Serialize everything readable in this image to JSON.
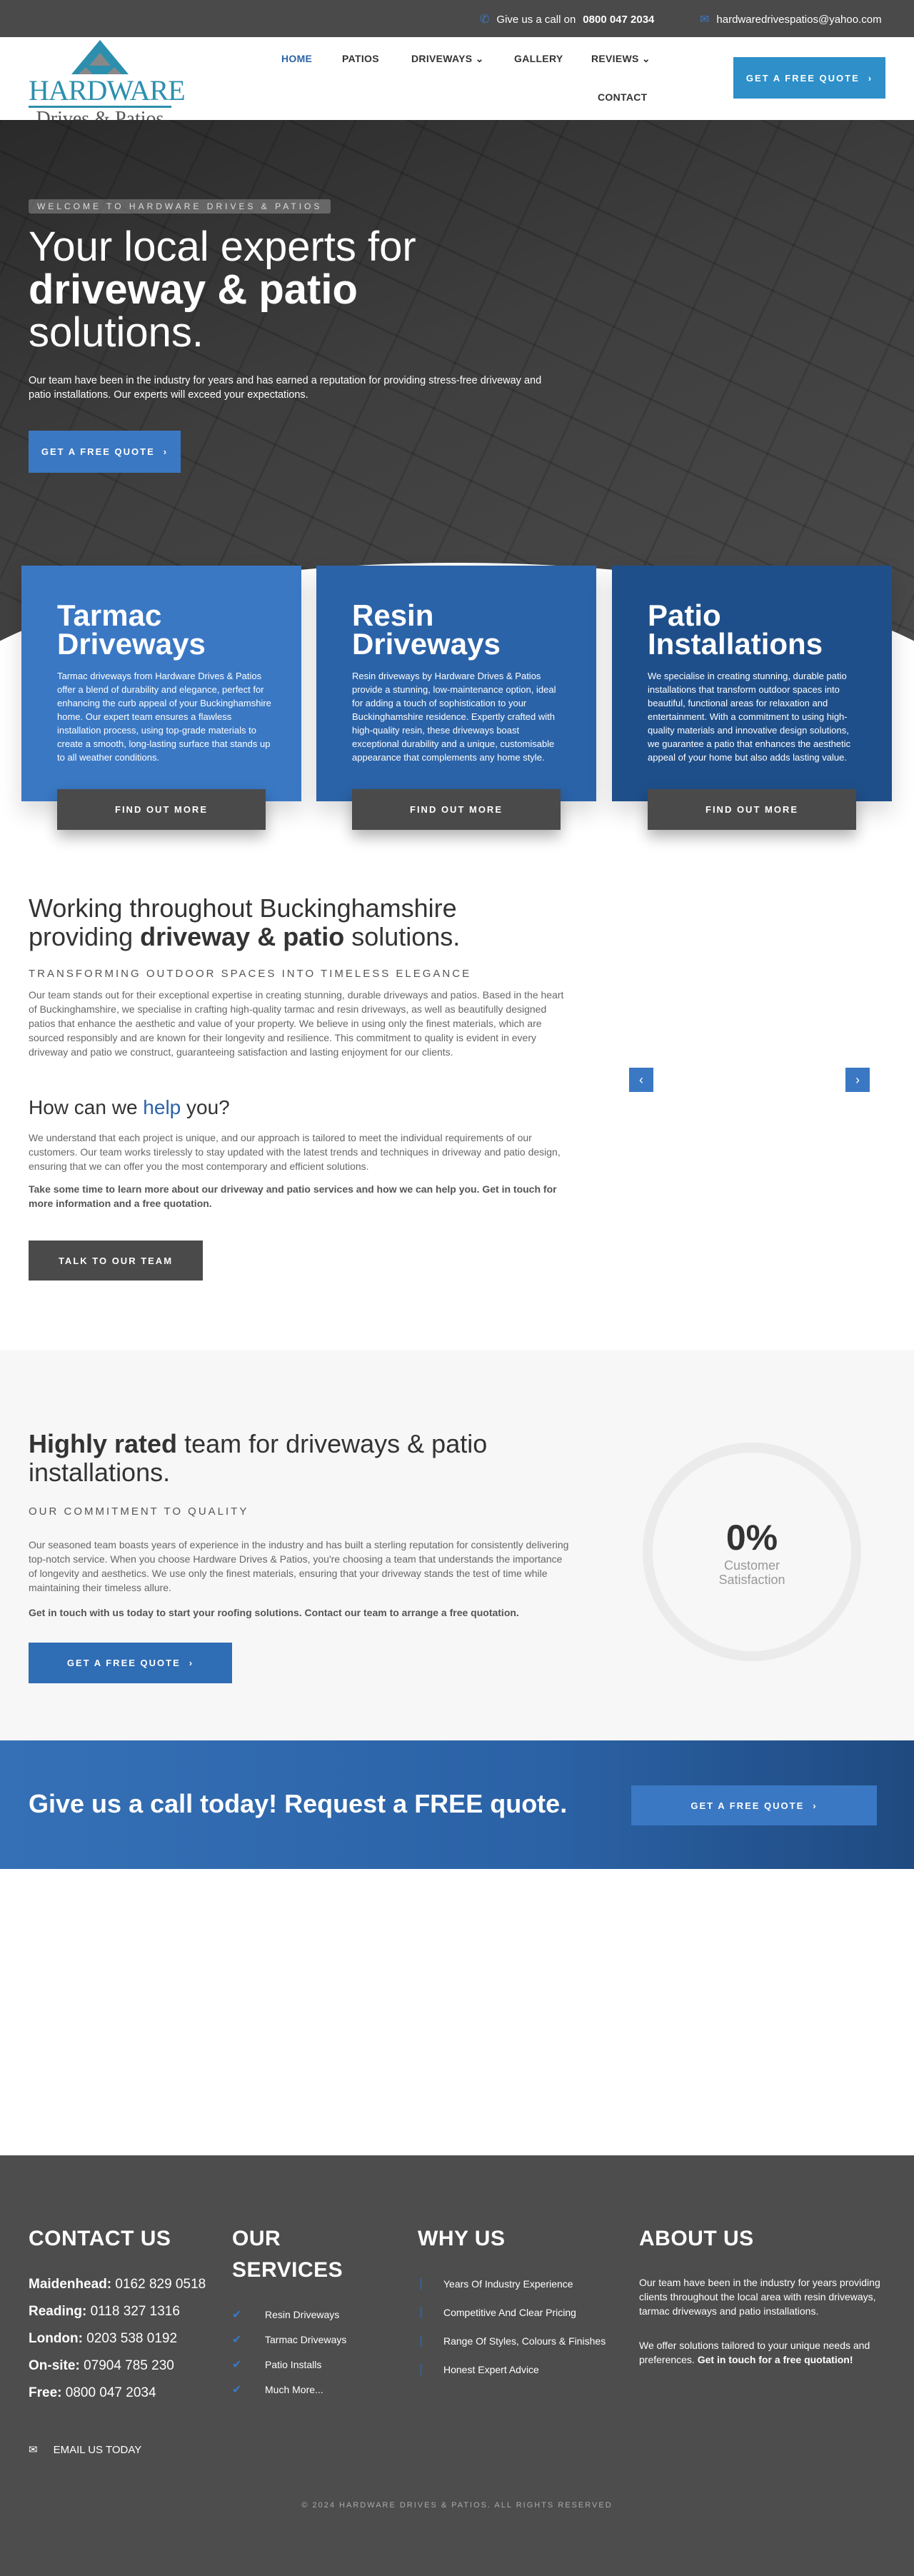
{
  "topbar": {
    "call_prefix": "Give us a call on",
    "phone": "0800 047 2034",
    "email": "hardwaredrivespatios@yahoo.com",
    "phone_icon": "phone-icon",
    "email_icon": "envelope-icon"
  },
  "header": {
    "logo_line1": "HARDWARE",
    "logo_line2": "Drives & Patios",
    "nav": [
      {
        "label": "HOME",
        "active": true
      },
      {
        "label": "PATIOS"
      },
      {
        "label": "DRIVEWAYS",
        "dropdown": true
      },
      {
        "label": "GALLERY"
      },
      {
        "label": "REVIEWS",
        "dropdown": true
      },
      {
        "label": "CONTACT"
      }
    ],
    "cta": "GET A FREE QUOTE"
  },
  "hero": {
    "badge": "WELCOME TO HARDWARE DRIVES & PATIOS",
    "title_line1": "Your local experts for",
    "title_bold": "driveway & patio",
    "title_line3": "solutions.",
    "text": "Our team have been in the industry for years and has earned a reputation for providing stress-free driveway and patio installations. Our experts will exceed your expectations.",
    "cta": "GET A FREE QUOTE"
  },
  "services": [
    {
      "title1": "Tarmac",
      "title2": "Driveways",
      "text": "Tarmac driveways from Hardware Drives & Patios offer a blend of durability and elegance, perfect for enhancing the curb appeal of your Buckinghamshire home. Our expert team ensures a flawless installation process, using top-grade materials to create a smooth, long-lasting surface that stands up to all weather conditions.",
      "button": "FIND OUT MORE",
      "color": "#3a78c4"
    },
    {
      "title1": "Resin",
      "title2": "Driveways",
      "text": "Resin driveways by Hardware Drives & Patios provide a stunning, low-maintenance option, ideal for adding a touch of sophistication to your Buckinghamshire residence. Expertly crafted with high-quality resin, these driveways boast exceptional durability and a unique, customisable appearance that complements any home style.",
      "button": "FIND OUT MORE",
      "color": "#2b63a8"
    },
    {
      "title1": "Patio",
      "title2": "Installations",
      "text": "We specialise in creating stunning, durable patio installations that transform outdoor spaces into beautiful, functional areas for relaxation and entertainment. With a commitment to using high-quality materials and innovative design solutions, we guarantee a patio that enhances the aesthetic appeal of your home but also adds lasting value.",
      "button": "FIND OUT MORE",
      "color": "#1f4f8a"
    }
  ],
  "about": {
    "title_line1": "Working throughout Buckinghamshire",
    "title_pre": "providing",
    "title_bold": "driveway & patio",
    "title_post": "solutions.",
    "subtitle": "TRANSFORMING OUTDOOR SPACES INTO TIMELESS ELEGANCE",
    "text": "Our team stands out for their exceptional expertise in creating stunning, durable driveways and patios. Based in the heart of Buckinghamshire, we specialise in crafting high-quality tarmac and resin driveways, as well as beautifully designed patios that enhance the aesthetic and value of your property. We believe in using only the finest materials, which are sourced responsibly and are known for their longevity and resilience. This commitment to quality is evident in every driveway and patio we construct, guaranteeing satisfaction and lasting enjoyment for our clients.",
    "help_pre": "How can we",
    "help_bold": "help",
    "help_post": "you?",
    "help_text": "We understand that each project is unique, and our approach is tailored to meet the individual requirements of our customers. Our team works tirelessly to stay updated with the latest trends and techniques in driveway and patio design, ensuring that we can offer you the most contemporary and efficient solutions.",
    "help_bold_text": "Take some time to learn more about our driveway and patio services and how we can help you. Get in touch for more information and a free quotation.",
    "button": "TALK TO OUR TEAM",
    "slider_prev": "‹",
    "slider_next": "›"
  },
  "rated": {
    "title_bold": "Highly rated",
    "title_rest": "team for driveways & patio installations.",
    "subtitle": "OUR COMMITMENT TO QUALITY",
    "text": "Our seasoned team boasts years of experience in the industry and has built a sterling reputation for consistently delivering top-notch service. When you choose Hardware Drives & Patios, you're choosing a team that understands the importance of longevity and aesthetics. We use only the finest materials, ensuring that your driveway stands the test of time while maintaining their timeless allure.",
    "bold_text": "Get in touch with us today to start your roofing solutions. Contact our team to arrange a free quotation.",
    "button": "GET A FREE QUOTE",
    "stat_value": "0%",
    "stat_percent": 0,
    "stat_label1": "Customer",
    "stat_label2": "Satisfaction"
  },
  "cta_band": {
    "text": "Give us a call today! Request a FREE quote.",
    "button": "GET A FREE QUOTE"
  },
  "footer": {
    "contact_title": "CONTACT US",
    "contacts": [
      {
        "label": "Maidenhead:",
        "value": "0162 829 0518"
      },
      {
        "label": "Reading:",
        "value": "0118 327 1316"
      },
      {
        "label": "London:",
        "value": "0203 538 0192"
      },
      {
        "label": "On-site:",
        "value": "07904 785 230"
      },
      {
        "label": "Free:",
        "value": "0800 047 2034"
      }
    ],
    "services_title1": "OUR",
    "services_title2": "SERVICES",
    "services": [
      "Resin Driveways",
      "Tarmac Driveways",
      "Patio Installs",
      "Much More..."
    ],
    "why_title": "WHY US",
    "why": [
      "Years Of Industry Experience",
      "Competitive And Clear Pricing",
      "Range Of Styles, Colours & Finishes",
      "Honest Expert Advice"
    ],
    "about_title": "ABOUT US",
    "about_text1": "Our team have been in the industry for years providing clients throughout the local area with resin driveways, tarmac driveways and patio installations.",
    "about_text2": "We offer solutions tailored to your unique needs and preferences.",
    "about_text2_bold": "Get in touch for a free quotation!",
    "email_link": "EMAIL US TODAY",
    "copyright": "© 2024 HARDWARE DRIVES & PATIOS. ALL RIGHTS RESERVED"
  },
  "colors": {
    "primary": "#3a78c4",
    "dark": "#4a4a4a",
    "footer": "#4d4d4d"
  }
}
